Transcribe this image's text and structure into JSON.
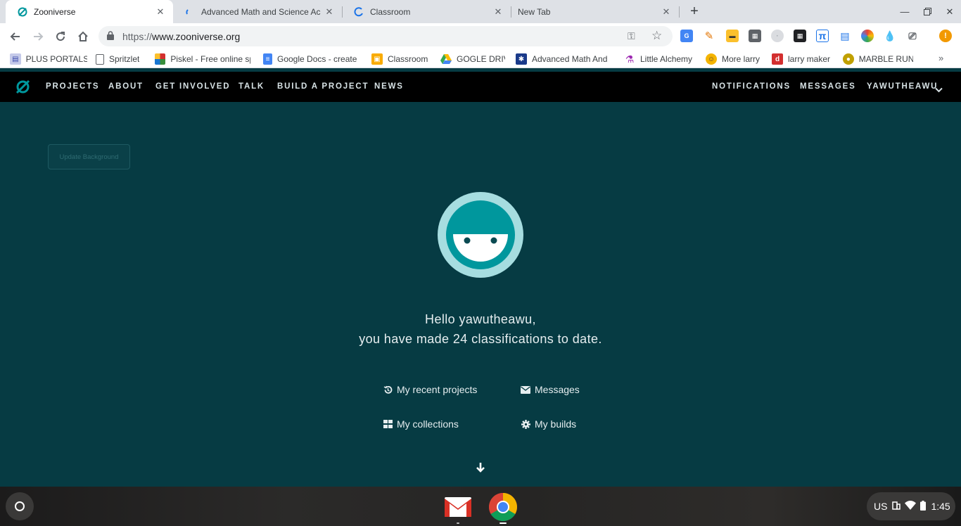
{
  "browser": {
    "tabs": [
      {
        "title": "Zooniverse",
        "active": true
      },
      {
        "title": "Advanced Math and Science Ac",
        "active": false
      },
      {
        "title": "Classroom",
        "active": false
      },
      {
        "title": "New Tab",
        "active": false
      }
    ],
    "url": {
      "scheme": "https://",
      "host": "www.zooniverse.org"
    },
    "bookmarks": [
      {
        "label": "PLUS PORTALS",
        "icon": "plus-portals-icon"
      },
      {
        "label": "Spritzlet",
        "icon": "page-icon"
      },
      {
        "label": "Piskel - Free online sp",
        "icon": "piskel-icon"
      },
      {
        "label": "Google Docs - create",
        "icon": "google-docs-icon"
      },
      {
        "label": "Classroom",
        "icon": "classroom-icon"
      },
      {
        "label": "GOGLE DRIV",
        "icon": "google-drive-icon"
      },
      {
        "label": "Advanced Math And",
        "icon": "snowflake-icon"
      },
      {
        "label": "Little Alchemy",
        "icon": "flask-icon"
      },
      {
        "label": "More larry",
        "icon": "emoji-icon"
      },
      {
        "label": "larry maker",
        "icon": "d-icon"
      },
      {
        "label": "MARBLE RUN",
        "icon": "marble-icon"
      }
    ]
  },
  "site": {
    "nav_left": [
      "PROJECTS",
      "ABOUT",
      "GET INVOLVED",
      "TALK",
      "BUILD A PROJECT",
      "NEWS"
    ],
    "nav_right": [
      "NOTIFICATIONS",
      "MESSAGES",
      "YAWUTHEAWU"
    ],
    "update_background": "Update Background",
    "greeting_line1": "Hello yawutheawu,",
    "greeting_line2": "you have made 24 classifications to date.",
    "actions": {
      "recent_projects": "My recent projects",
      "messages": "Messages",
      "collections": "My collections",
      "builds": "My builds"
    },
    "colors": {
      "background": "#063b43",
      "brand": "#00979d",
      "nav": "#000000"
    }
  },
  "shelf": {
    "apps": [
      "gmail-icon",
      "chrome-icon"
    ],
    "tray": {
      "locale": "US",
      "time": "1:45"
    }
  }
}
